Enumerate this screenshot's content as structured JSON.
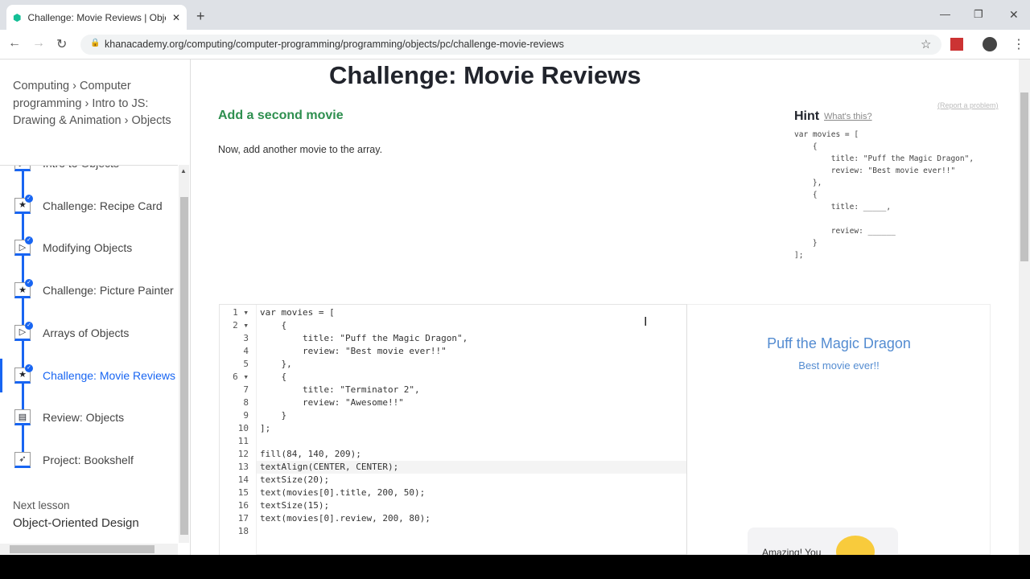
{
  "browser": {
    "tab_title": "Challenge: Movie Reviews | Obje",
    "url": "khanacademy.org/computing/computer-programming/programming/objects/pc/challenge-movie-reviews"
  },
  "breadcrumb": [
    "Computing",
    "Computer programming",
    "Intro to JS: Drawing & Animation",
    "Objects"
  ],
  "lessons": [
    {
      "label": "Intro to Objects",
      "icon": "play-icon",
      "done": true
    },
    {
      "label": "Challenge: Recipe Card",
      "icon": "star-icon",
      "done": true
    },
    {
      "label": "Modifying Objects",
      "icon": "play-icon",
      "done": true
    },
    {
      "label": "Challenge: Picture Painter",
      "icon": "star-icon",
      "done": true
    },
    {
      "label": "Arrays of Objects",
      "icon": "play-icon",
      "done": true
    },
    {
      "label": "Challenge: Movie Reviews",
      "icon": "star-icon",
      "done": true,
      "active": true
    },
    {
      "label": "Review: Objects",
      "icon": "document-icon",
      "done": false
    },
    {
      "label": "Project: Bookshelf",
      "icon": "rocket-icon",
      "done": false
    }
  ],
  "next_lesson": {
    "label": "Next lesson",
    "title": "Object-Oriented Design"
  },
  "main": {
    "title": "Challenge: Movie Reviews",
    "step_title": "Add a second movie",
    "step_desc": "Now, add another movie to the array.",
    "hint_label": "Hint",
    "whats_this": "What's this?",
    "report": "(Report a problem)",
    "hint_code": "var movies = [\n    {\n        title: \"Puff the Magic Dragon\",\n        review: \"Best movie ever!!\"\n    },\n    {\n        title: _____,\n\n        review: ______\n    }\n];"
  },
  "editor": {
    "lines": [
      "var movies = [",
      "    {",
      "        title: \"Puff the Magic Dragon\",",
      "        review: \"Best movie ever!!\"",
      "    },",
      "    {",
      "        title: \"Terminator 2\",",
      "        review: \"Awesome!!\"",
      "    }",
      "];",
      "",
      "fill(84, 140, 209);",
      "textAlign(CENTER, CENTER);",
      "textSize(20);",
      "text(movies[0].title, 200, 50);",
      "textSize(15);",
      "text(movies[0].review, 200, 80);",
      ""
    ],
    "fold_lines": [
      1,
      2,
      6
    ],
    "current_line": 13
  },
  "output": {
    "title": "Puff the Magic Dragon",
    "review": "Best movie ever!!",
    "fill_color": "#548cd1",
    "toast": "Amazing! You"
  },
  "colors": {
    "accent": "#1865f2",
    "green": "#2e8f4f"
  }
}
